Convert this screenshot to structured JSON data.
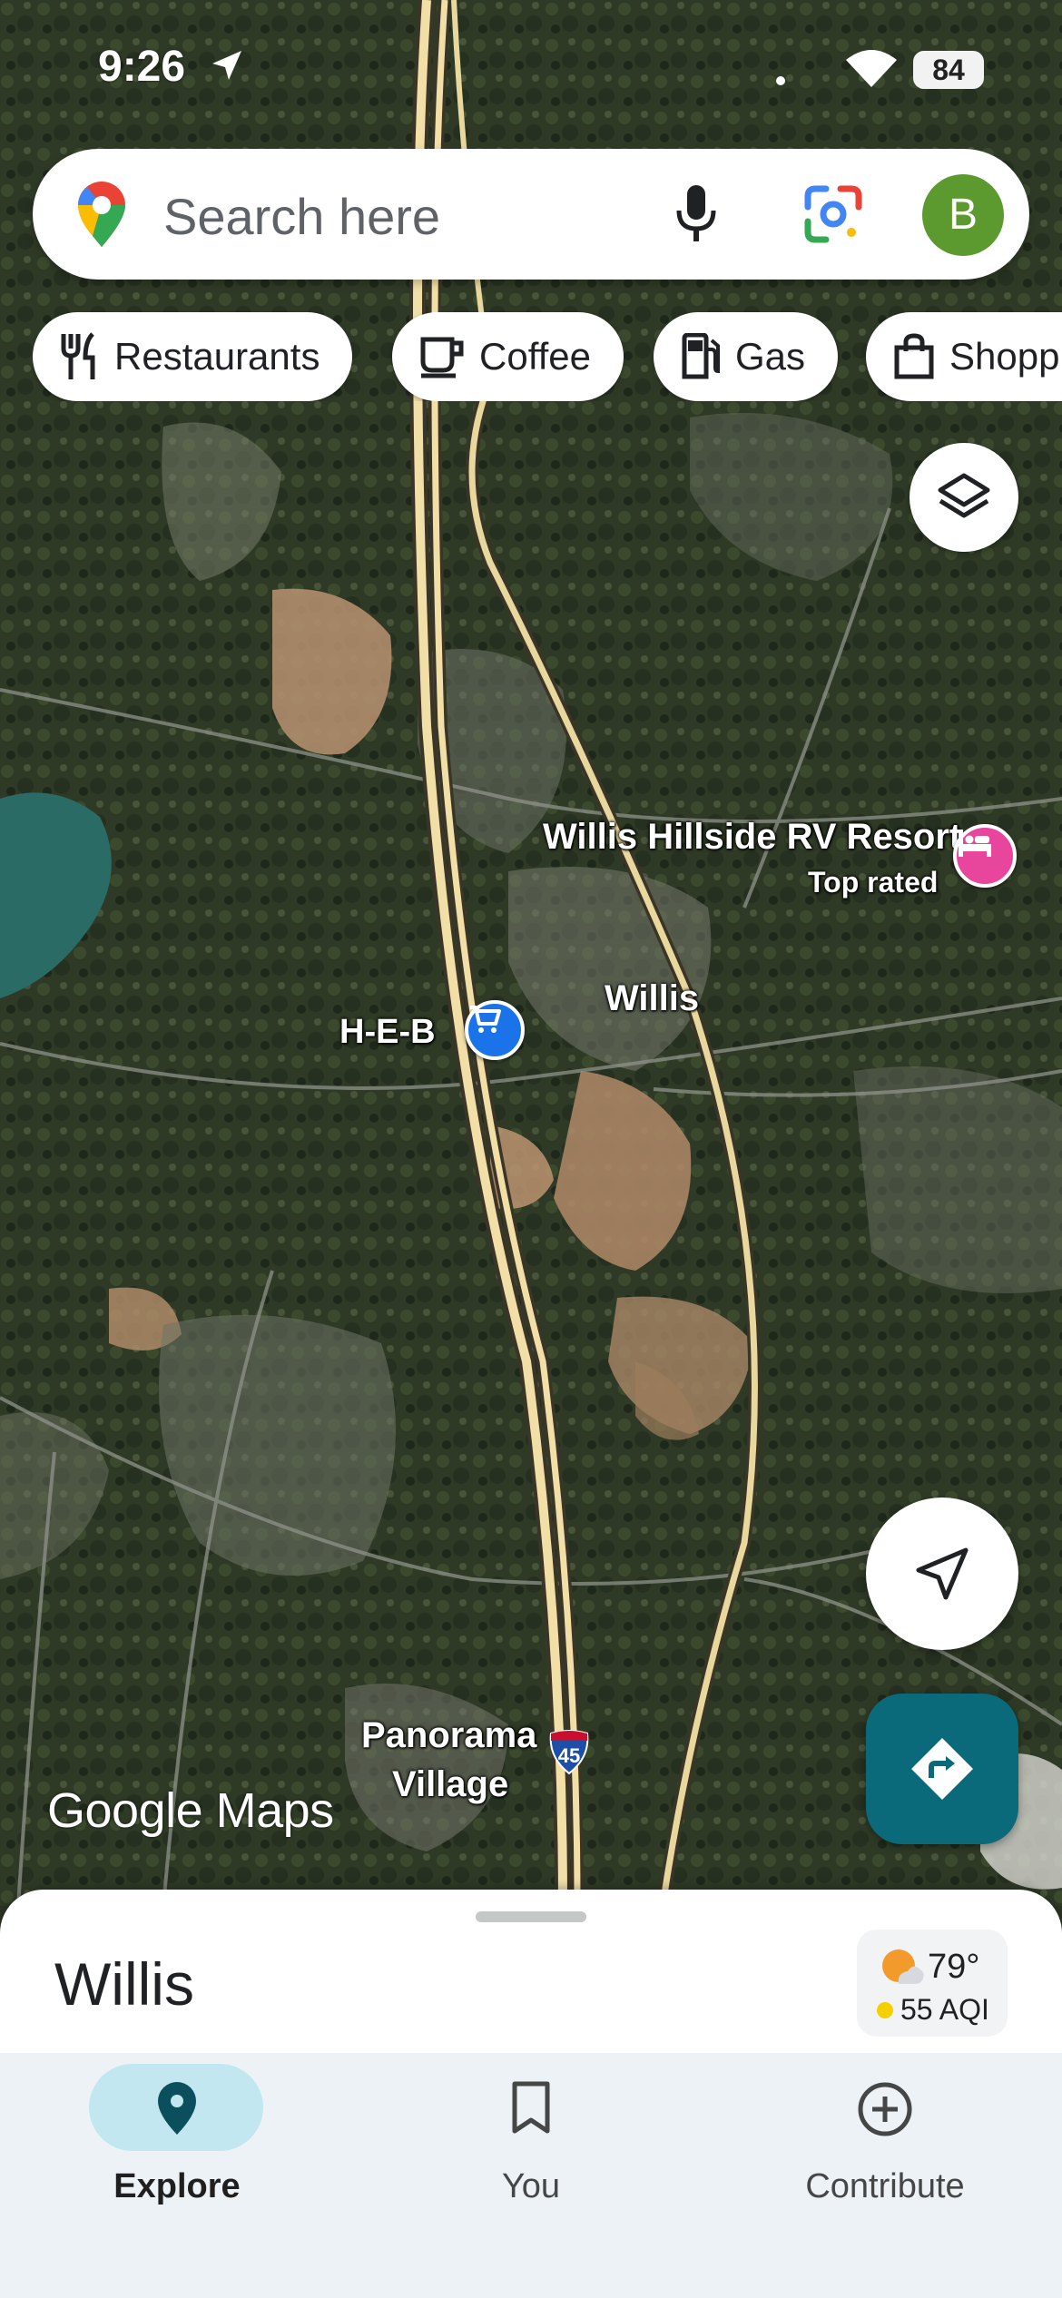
{
  "status_bar": {
    "time": "9:26",
    "battery": "84"
  },
  "search": {
    "placeholder": "Search here",
    "avatar_initial": "B"
  },
  "chips": [
    {
      "label": "Restaurants",
      "icon": "fork-knife-icon"
    },
    {
      "label": "Coffee",
      "icon": "coffee-cup-icon"
    },
    {
      "label": "Gas",
      "icon": "gas-pump-icon"
    },
    {
      "label": "Shopping",
      "icon": "shopping-bag-icon"
    }
  ],
  "map": {
    "labels": {
      "rv_resort": "Willis Hillside RV Resort",
      "rv_resort_sub": "Top rated",
      "willis": "Willis",
      "heb": "H-E-B",
      "panorama_line1": "Panorama",
      "panorama_line2": "Village",
      "interstate": "45"
    },
    "watermark": "Google Maps"
  },
  "sheet": {
    "title": "Willis",
    "weather": {
      "temp": "79°",
      "aqi": "55 AQI"
    }
  },
  "nav": {
    "explore": "Explore",
    "you": "You",
    "contribute": "Contribute"
  },
  "colors": {
    "accent": "#0b6a7a",
    "nav_active_pill": "#c2e7f1",
    "avatar": "#5c9a2f",
    "rv_poi": "#e8459c",
    "shopping_poi": "#1a73e8"
  }
}
